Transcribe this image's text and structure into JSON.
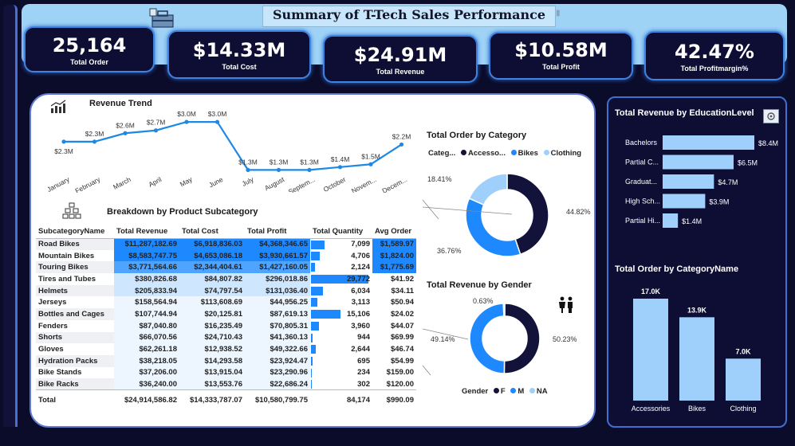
{
  "header": {
    "title": "Summary of T-Tech Sales Performance"
  },
  "kpis": [
    {
      "value": "25,164",
      "label": "Total Order"
    },
    {
      "value": "$14.33M",
      "label": "Total Cost"
    },
    {
      "value": "$24.91M",
      "label": "Total Revenue"
    },
    {
      "value": "$10.58M",
      "label": "Total Profit"
    },
    {
      "value": "42.47%",
      "label": "Total Profitmargin%"
    }
  ],
  "revenue_trend": {
    "title": "Revenue Trend",
    "months": [
      "January",
      "February",
      "March",
      "April",
      "May",
      "June",
      "July",
      "August",
      "Septem...",
      "October",
      "Novem...",
      "Decem..."
    ],
    "labels": [
      "$2.3M",
      "$2.3M",
      "$2.6M",
      "$2.7M",
      "$3.0M",
      "$3.0M",
      "$1.3M",
      "$1.3M",
      "$1.3M",
      "$1.4M",
      "$1.5M",
      "$2.2M"
    ],
    "values": [
      2.3,
      2.3,
      2.6,
      2.7,
      3.0,
      3.0,
      1.3,
      1.3,
      1.3,
      1.4,
      1.5,
      2.2
    ]
  },
  "subcategory_table": {
    "title": "Breakdown by Product Subcategory",
    "columns": [
      "SubcategoryName",
      "Total Revenue",
      "Total Cost",
      "Total Profit",
      "Total Quantity",
      "Avg Order"
    ],
    "rows": [
      [
        "Road Bikes",
        "$11,287,182.69",
        "$6,918,836.03",
        "$4,368,346.65",
        "7,099",
        "$1,589.97"
      ],
      [
        "Mountain Bikes",
        "$8,583,747.75",
        "$4,653,086.18",
        "$3,930,661.57",
        "4,706",
        "$1,824.00"
      ],
      [
        "Touring Bikes",
        "$3,771,564.66",
        "$2,344,404.61",
        "$1,427,160.05",
        "2,124",
        "$1,775.69"
      ],
      [
        "Tires and Tubes",
        "$380,826.68",
        "$84,807.82",
        "$296,018.86",
        "29,772",
        "$41.92"
      ],
      [
        "Helmets",
        "$205,833.94",
        "$74,797.54",
        "$131,036.40",
        "6,034",
        "$34.11"
      ],
      [
        "Jerseys",
        "$158,564.94",
        "$113,608.69",
        "$44,956.25",
        "3,113",
        "$50.94"
      ],
      [
        "Bottles and Cages",
        "$107,744.94",
        "$20,125.81",
        "$87,619.13",
        "15,106",
        "$24.02"
      ],
      [
        "Fenders",
        "$87,040.80",
        "$16,235.49",
        "$70,805.31",
        "3,960",
        "$44.07"
      ],
      [
        "Shorts",
        "$66,070.56",
        "$24,710.43",
        "$41,360.13",
        "944",
        "$69.99"
      ],
      [
        "Gloves",
        "$62,261.18",
        "$12,938.52",
        "$49,322.66",
        "2,644",
        "$46.74"
      ],
      [
        "Hydration Packs",
        "$38,218.05",
        "$14,293.58",
        "$23,924.47",
        "695",
        "$54.99"
      ],
      [
        "Bike Stands",
        "$37,206.00",
        "$13,915.04",
        "$23,290.96",
        "234",
        "$159.00"
      ],
      [
        "Bike Racks",
        "$36,240.00",
        "$13,553.76",
        "$22,686.24",
        "302",
        "$120.00"
      ]
    ],
    "quantities": [
      7099,
      4706,
      2124,
      29772,
      6034,
      3113,
      15106,
      3960,
      944,
      2644,
      695,
      234,
      302
    ],
    "total": [
      "Total",
      "$24,914,586.82",
      "$14,333,787.07",
      "$10,580,799.75",
      "84,174",
      "$990.09"
    ]
  },
  "order_by_category": {
    "title": "Total Order by Category",
    "legend_title": "Categ...",
    "legend": [
      "Accesso...",
      "Bikes",
      "Clothing"
    ],
    "values": [
      44.82,
      36.76,
      18.41
    ],
    "labels": [
      "44.82%",
      "36.76%",
      "18.41%"
    ],
    "colors": [
      "#12123a",
      "#1e88ff",
      "#9fd0fb"
    ]
  },
  "revenue_by_gender": {
    "title": "Total Revenue by Gender",
    "legend_title": "Gender",
    "legend": [
      "F",
      "M",
      "NA"
    ],
    "values": [
      50.23,
      49.14,
      0.63
    ],
    "labels": [
      "50.23%",
      "49.14%",
      "0.63%"
    ],
    "colors": [
      "#12123a",
      "#1e88ff",
      "#9fd0fb"
    ]
  },
  "revenue_by_education": {
    "title": "Total Revenue by EducationLevel",
    "categories": [
      "Bachelors",
      "Partial C...",
      "Graduat...",
      "High Sch...",
      "Partial Hi..."
    ],
    "values": [
      8.4,
      6.5,
      4.7,
      3.9,
      1.4
    ],
    "labels": [
      "$8.4M",
      "$6.5M",
      "$4.7M",
      "$3.9M",
      "$1.4M"
    ]
  },
  "order_by_categoryname": {
    "title": "Total Order by CategoryName",
    "categories": [
      "Accessories",
      "Bikes",
      "Clothing"
    ],
    "values": [
      17.0,
      13.9,
      7.0
    ],
    "labels": [
      "17.0K",
      "13.9K",
      "7.0K"
    ]
  },
  "colors": {
    "accent": "#1e88ff",
    "light": "#9fd0fb",
    "dark": "#12123a",
    "panel": "#0e0e35"
  }
}
